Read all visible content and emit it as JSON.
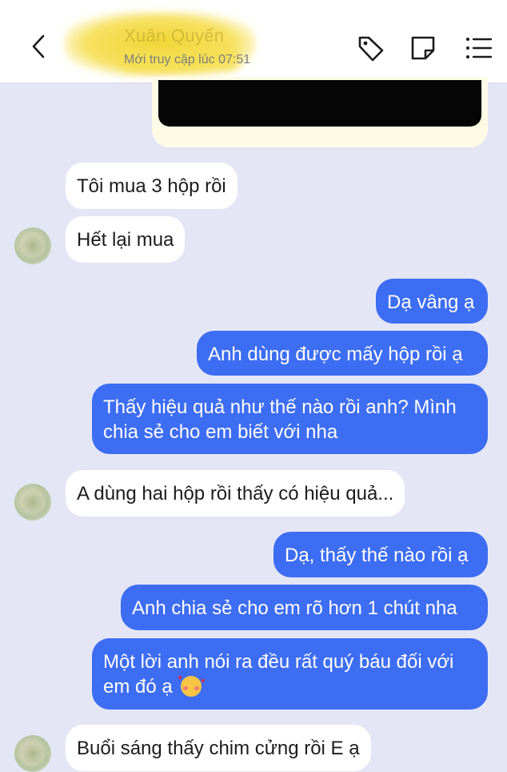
{
  "header": {
    "contact_name": "Xuân Quyến",
    "status": "Mới truy cập lúc 07:51",
    "icons": [
      "back-chevron-icon",
      "tag-icon",
      "note-icon",
      "menu-list-icon"
    ]
  },
  "messages": [
    {
      "dir": "in",
      "text": "Tôi mua 3 hộp rồi"
    },
    {
      "dir": "in",
      "text": "Hết lại mua"
    },
    {
      "dir": "out",
      "text": "Dạ vâng ạ"
    },
    {
      "dir": "out",
      "text": "Anh dùng được mấy hộp rồi ạ"
    },
    {
      "dir": "out",
      "text": "Thấy hiệu quả như thế nào rồi anh? Mình chia sẻ cho em biết với nha"
    },
    {
      "dir": "in",
      "text": "A dùng hai hộp rồi thấy có hiệu quả..."
    },
    {
      "dir": "out",
      "text": "Dạ, thấy thế nào rồi ạ"
    },
    {
      "dir": "out",
      "text": "Anh chia sẻ cho em rõ hơn 1 chút nha"
    },
    {
      "dir": "out",
      "text": "Một lời anh nói ra đều rất quý báu đối với em đó ạ",
      "emoji": "smiling-face-with-hearts"
    },
    {
      "dir": "in",
      "text": "Buổi sáng thấy chim cửng rồi E ạ"
    }
  ],
  "colors": {
    "background": "#e4e6f5",
    "outgoing_bubble": "#3d6df2",
    "incoming_bubble": "#ffffff"
  }
}
